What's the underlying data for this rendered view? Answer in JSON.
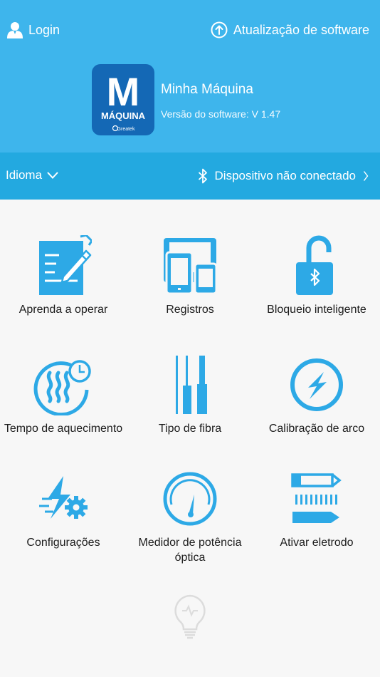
{
  "topbar": {
    "login_label": "Login",
    "update_label": "Atualização de software"
  },
  "app": {
    "logo_letter": "M",
    "logo_word": "MÁQUINA",
    "logo_brand": "Greatek",
    "name": "Minha Máquina",
    "version": "Versão do software: V 1.47"
  },
  "status": {
    "language_label": "Idioma",
    "device_label": "Dispositivo não conectado"
  },
  "menu": [
    {
      "label": "Aprenda a operar",
      "icon": "notebook-pencil-icon"
    },
    {
      "label": "Registros",
      "icon": "devices-icon"
    },
    {
      "label": "Bloqueio inteligente",
      "icon": "bluetooth-lock-icon"
    },
    {
      "label": "Tempo de aquecimento",
      "icon": "heat-timer-icon"
    },
    {
      "label": "Tipo de fibra",
      "icon": "fiber-type-icon"
    },
    {
      "label": "Calibração de arco",
      "icon": "arc-calibration-icon"
    },
    {
      "label": "Configurações",
      "icon": "settings-bolt-icon"
    },
    {
      "label": "Medidor de potência óptica",
      "icon": "power-meter-icon"
    },
    {
      "label": "Ativar eletrodo",
      "icon": "electrode-icon"
    }
  ],
  "colors": {
    "header": "#3eb5ec",
    "statusbar": "#23a9e0",
    "icon": "#2da9e6",
    "logo": "#1468b5",
    "background": "#f7f7f7"
  }
}
